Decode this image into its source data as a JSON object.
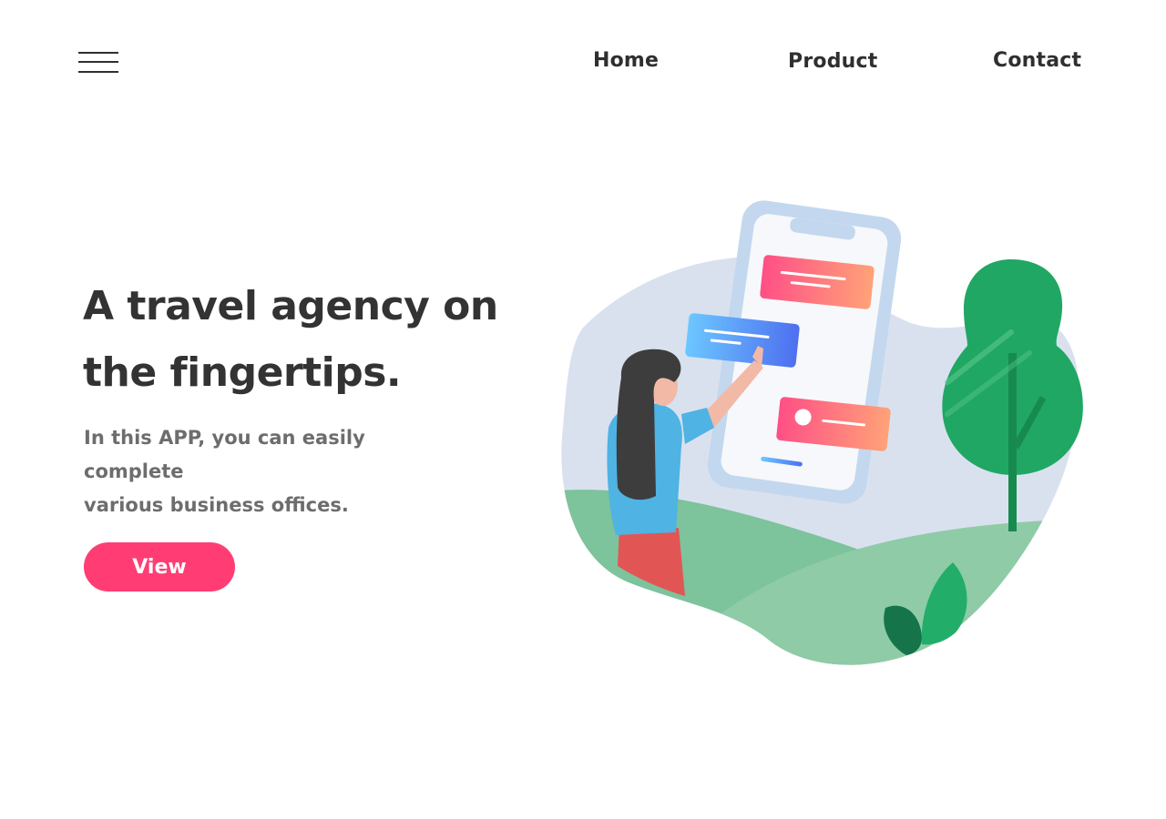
{
  "header": {
    "menu_icon": "hamburger-menu-icon",
    "nav": {
      "home": "Home",
      "product": "Product",
      "contact": "Contact"
    }
  },
  "hero": {
    "title_line1": "A travel agency on",
    "title_line2": "the fingertips.",
    "subtitle_line1": "In this APP, you can easily complete",
    "subtitle_line2": "various business offices.",
    "cta_label": "View"
  },
  "colors": {
    "accent": "#ff3d74",
    "heading": "#333333",
    "subtext": "#6d6d6d",
    "nav": "#2f2f2f"
  },
  "illustration": {
    "subject": "woman-tapping-phone-illustration"
  }
}
